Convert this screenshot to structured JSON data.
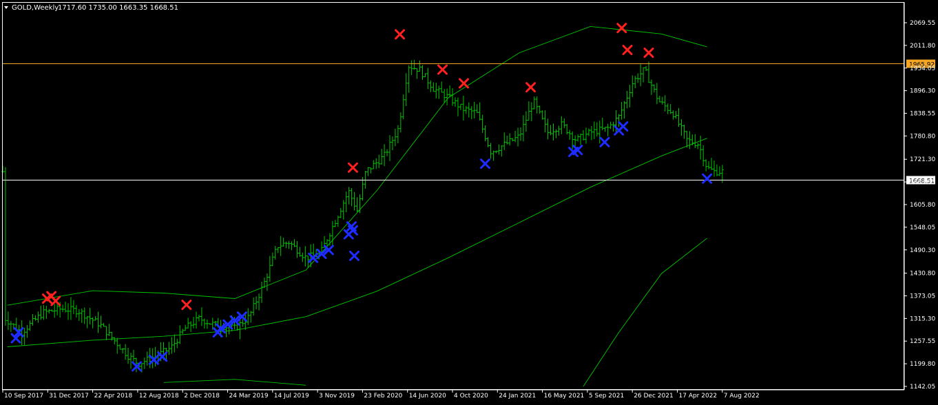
{
  "window": {
    "symbol_timeframe": "GOLD,Weekly",
    "ohlc": "1717.60 1735.00 1663.35 1668.51",
    "background_color": "#000000",
    "axis_color": "#ffffff",
    "menu_icon": "triangle-down-icon"
  },
  "chart_data": {
    "type": "line",
    "title": "GOLD,Weekly",
    "ohlc_last": {
      "open": 1717.6,
      "high": 1735.0,
      "low": 1663.35,
      "close": 1668.51
    },
    "ylim": [
      1142.05,
      2095
    ],
    "y_ticks": [
      "2069.55",
      "2011.80",
      "1954.05",
      "1896.30",
      "1838.55",
      "1780.80",
      "1721.30",
      "1663.55",
      "1605.80",
      "1548.05",
      "1490.30",
      "1430.80",
      "1373.05",
      "1315.30",
      "1257.55",
      "1199.80",
      "1142.05"
    ],
    "x_ticks": [
      "10 Sep 2017",
      "31 Dec 2017",
      "22 Apr 2018",
      "12 Aug 2018",
      "2 Dec 2018",
      "24 Mar 2019",
      "14 Jul 2019",
      "3 Nov 2019",
      "23 Feb 2020",
      "14 Jun 2020",
      "4 Oct 2020",
      "24 Jan 2021",
      "16 May 2021",
      "5 Sep 2021",
      "26 Dec 2021",
      "17 Apr 2022",
      "7 Aug 2022"
    ],
    "price_lines": [
      {
        "value": 1965.92,
        "label": "1965.92",
        "color": "#f5a623"
      },
      {
        "value": 1668.51,
        "label": "1668.51",
        "color": "#ffffff"
      }
    ],
    "bars_color": "#00c800",
    "band_color": "#00c800",
    "band_series": [
      {
        "x": [
          2017.7,
          2018.3,
          2018.8,
          2019.3,
          2019.8,
          2020.3,
          2020.8,
          2021.3,
          2021.8,
          2022.3,
          2022.62
        ],
        "values": [
          1349,
          1386,
          1380,
          1366,
          1439,
          1642,
          1878,
          1993,
          2060,
          2041,
          2008
        ]
      },
      {
        "x": [
          2017.7,
          2018.3,
          2018.8,
          2019.3,
          2019.8,
          2020.3,
          2020.8,
          2021.3,
          2021.8,
          2022.3,
          2022.62
        ],
        "values": [
          1243,
          1260,
          1270,
          1285,
          1320,
          1385,
          1470,
          1560,
          1650,
          1730,
          1775
        ]
      },
      {
        "x": [
          2018.8,
          2019.3,
          2019.8
        ],
        "values": [
          1152,
          1160,
          1145
        ]
      },
      {
        "x": [
          2021.75,
          2022.0,
          2022.3,
          2022.62
        ],
        "values": [
          1142,
          1280,
          1430,
          1520
        ]
      }
    ],
    "sell_signals": {
      "color": "#ff2020",
      "x": [
        2017.98,
        2018.01,
        2018.04,
        2018.96,
        2020.13,
        2020.46,
        2020.76,
        2020.91,
        2021.38,
        2022.02,
        2022.06,
        2022.21
      ],
      "values": [
        1366,
        1372,
        1360,
        1350,
        1700,
        2040,
        1950,
        1915,
        1905,
        2056,
        2000,
        1993
      ]
    },
    "buy_signals": {
      "color": "#1e2cff",
      "x": [
        2017.76,
        2017.78,
        2018.61,
        2018.73,
        2018.79,
        2019.18,
        2019.2,
        2019.25,
        2019.3,
        2019.35,
        2019.85,
        2019.91,
        2019.96,
        2020.1,
        2020.12,
        2020.14,
        2020.13,
        2021.06,
        2021.68,
        2021.71,
        2021.9,
        2022.0,
        2022.03,
        2022.62
      ],
      "values": [
        1265,
        1280,
        1193,
        1210,
        1218,
        1280,
        1290,
        1300,
        1310,
        1320,
        1470,
        1480,
        1490,
        1530,
        1550,
        1475,
        1540,
        1710,
        1740,
        1745,
        1765,
        1795,
        1805,
        1672
      ]
    }
  }
}
